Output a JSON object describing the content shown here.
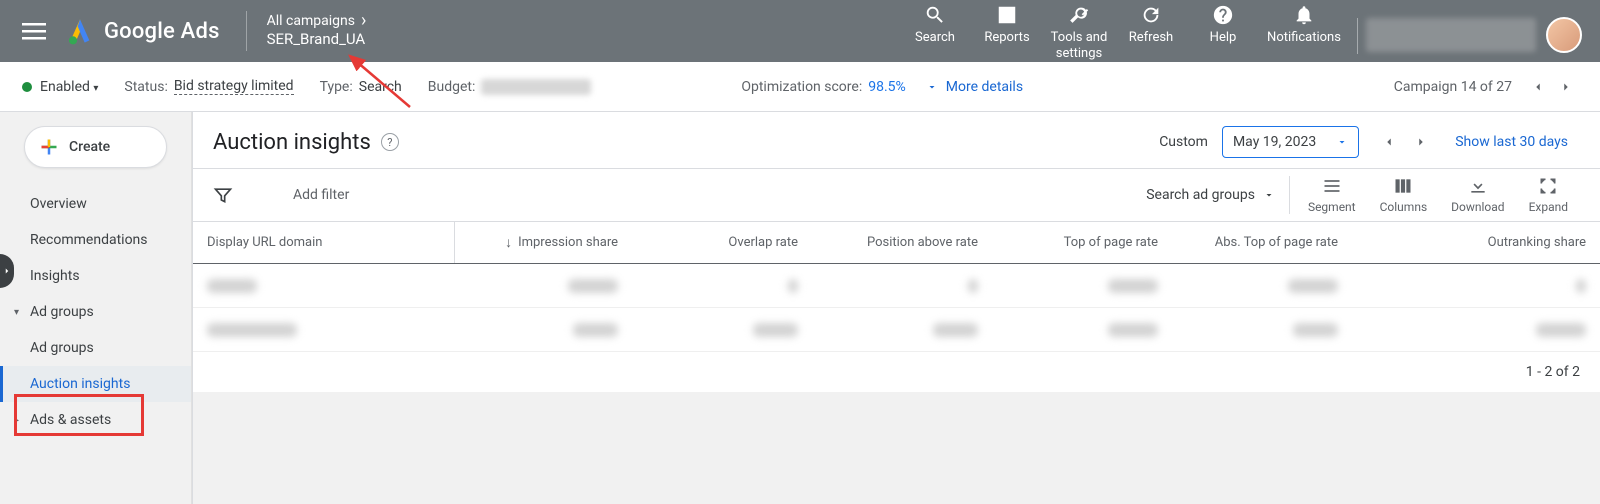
{
  "header": {
    "product_name": "Google Ads",
    "breadcrumb_top": "All campaigns",
    "breadcrumb_campaign": "SER_Brand_UA",
    "actions": {
      "search": "Search",
      "reports": "Reports",
      "tools": "Tools and settings",
      "refresh": "Refresh",
      "help": "Help",
      "notifications": "Notifications"
    }
  },
  "subbar": {
    "enabled_label": "Enabled",
    "status_label": "Status:",
    "status_value": "Bid strategy limited",
    "type_label": "Type:",
    "type_value": "Search",
    "budget_label": "Budget:",
    "opt_label": "Optimization score:",
    "opt_value": "98.5%",
    "more_details": "More details",
    "pager_text": "Campaign 14 of 27"
  },
  "sidebar": {
    "create_label": "Create",
    "items": [
      {
        "label": "Overview"
      },
      {
        "label": "Recommendations"
      },
      {
        "label": "Insights"
      },
      {
        "label": "Ad groups"
      },
      {
        "label": "Ad groups"
      },
      {
        "label": "Auction insights"
      },
      {
        "label": "Ads & assets"
      }
    ]
  },
  "main": {
    "title": "Auction insights",
    "date_range_type": "Custom",
    "date_value": "May 19, 2023",
    "show_last": "Show last 30 days",
    "filter": {
      "add_filter": "Add filter",
      "search_adgroups": "Search ad groups",
      "segment": "Segment",
      "columns": "Columns",
      "download": "Download",
      "expand": "Expand"
    },
    "columns": [
      "Display URL domain",
      "Impression share",
      "Overlap rate",
      "Position above rate",
      "Top of page rate",
      "Abs. Top of page rate",
      "Outranking share"
    ],
    "footer_text": "1 - 2 of 2"
  }
}
